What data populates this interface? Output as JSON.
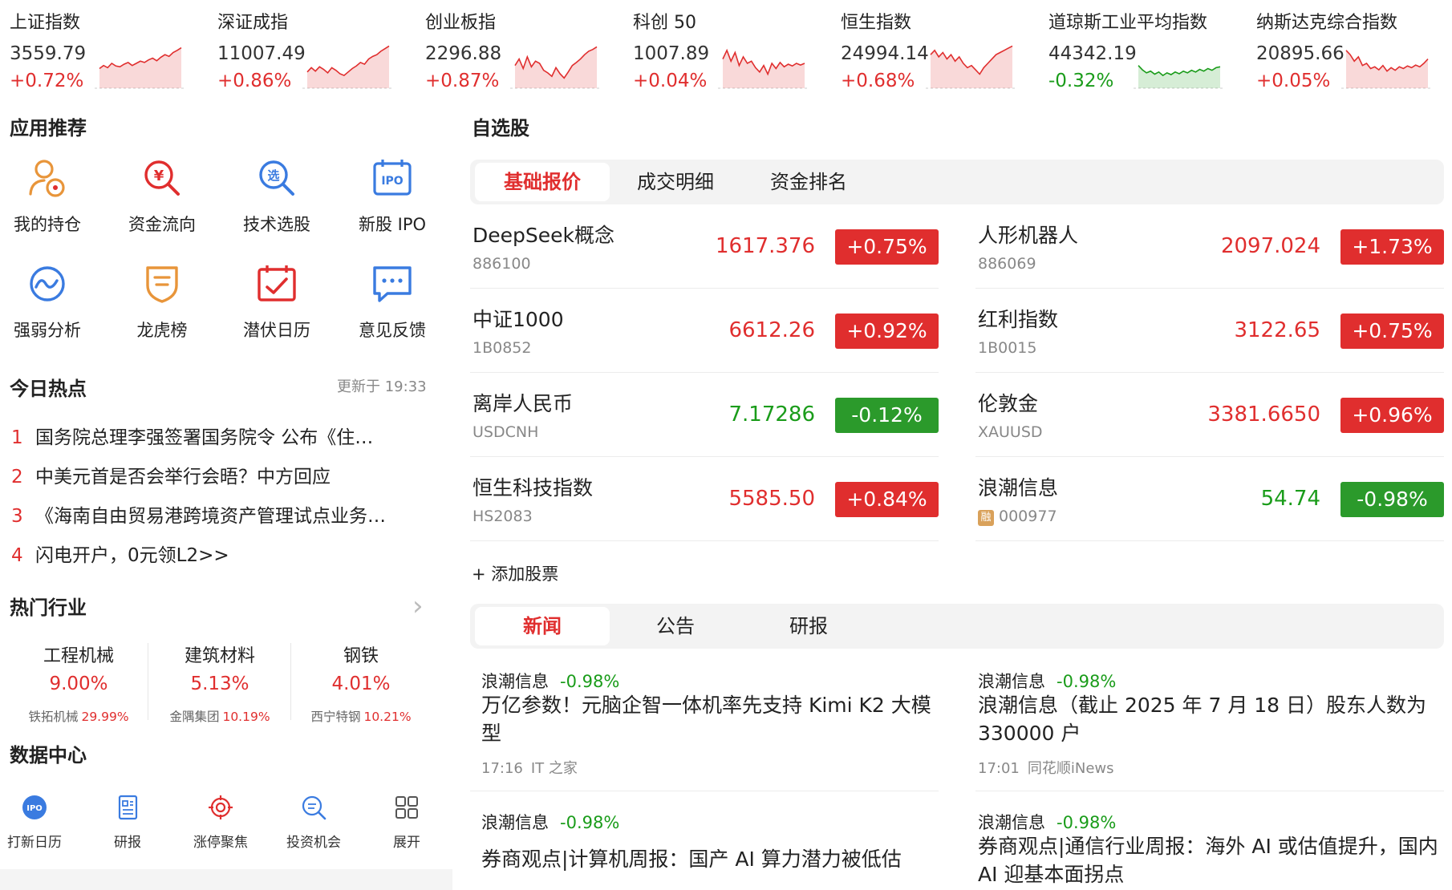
{
  "indices": [
    {
      "name": "上证指数",
      "value": "3559.79",
      "change": "+0.72%",
      "dir": "up"
    },
    {
      "name": "深证成指",
      "value": "11007.49",
      "change": "+0.86%",
      "dir": "up"
    },
    {
      "name": "创业板指",
      "value": "2296.88",
      "change": "+0.87%",
      "dir": "up"
    },
    {
      "name": "科创 50",
      "value": "1007.89",
      "change": "+0.04%",
      "dir": "up"
    },
    {
      "name": "恒生指数",
      "value": "24994.14",
      "change": "+0.68%",
      "dir": "up"
    },
    {
      "name": "道琼斯工业平均指数",
      "value": "44342.19",
      "change": "-0.32%",
      "dir": "down"
    },
    {
      "name": "纳斯达克综合指数",
      "value": "20895.66",
      "change": "+0.05%",
      "dir": "up"
    }
  ],
  "apps": {
    "title": "应用推荐",
    "items": [
      {
        "label": "我的持仓",
        "icon": "holdings-icon"
      },
      {
        "label": "资金流向",
        "icon": "capital-flow-icon"
      },
      {
        "label": "技术选股",
        "icon": "stock-picker-icon"
      },
      {
        "label": "新股 IPO",
        "icon": "ipo-icon"
      },
      {
        "label": "强弱分析",
        "icon": "strength-analysis-icon"
      },
      {
        "label": "龙虎榜",
        "icon": "dragon-tiger-icon"
      },
      {
        "label": "潜伏日历",
        "icon": "calendar-icon"
      },
      {
        "label": "意见反馈",
        "icon": "feedback-icon"
      }
    ]
  },
  "hot": {
    "title": "今日热点",
    "updated": "更新于 19:33",
    "items": [
      {
        "num": "1",
        "text": "国务院总理李强签署国务院令 公布《住…"
      },
      {
        "num": "2",
        "text": "中美元首是否会举行会晤？中方回应"
      },
      {
        "num": "3",
        "text": "《海南自由贸易港跨境资产管理试点业务…"
      },
      {
        "num": "4",
        "text": "闪电开户，0元领L2>>"
      }
    ]
  },
  "industries": {
    "title": "热门行业",
    "chevron": "›",
    "items": [
      {
        "name": "工程机械",
        "pct": "9.00%",
        "leader": "铁拓机械",
        "leader_pct": "29.99%"
      },
      {
        "name": "建筑材料",
        "pct": "5.13%",
        "leader": "金隅集团",
        "leader_pct": "10.19%"
      },
      {
        "name": "钢铁",
        "pct": "4.01%",
        "leader": "西宁特钢",
        "leader_pct": "10.21%"
      }
    ]
  },
  "datacenter": {
    "title": "数据中心",
    "items": [
      {
        "label": "打新日历",
        "icon": "ipo-calendar-icon",
        "icon_text": "IPO"
      },
      {
        "label": "研报",
        "icon": "research-report-icon"
      },
      {
        "label": "涨停聚焦",
        "icon": "limit-up-target-icon"
      },
      {
        "label": "投资机会",
        "icon": "opportunity-search-icon"
      },
      {
        "label": "展开",
        "icon": "expand-grid-icon"
      }
    ]
  },
  "watchlist": {
    "title": "自选股",
    "tabs": [
      "基础报价",
      "成交明细",
      "资金排名"
    ],
    "active_tab": 0,
    "stocks": [
      {
        "name": "DeepSeek概念",
        "code": "886100",
        "price": "1617.376",
        "change": "+0.75%",
        "dir": "up"
      },
      {
        "name": "人形机器人",
        "code": "886069",
        "price": "2097.024",
        "change": "+1.73%",
        "dir": "up"
      },
      {
        "name": "中证1000",
        "code": "1B0852",
        "price": "6612.26",
        "change": "+0.92%",
        "dir": "up"
      },
      {
        "name": "红利指数",
        "code": "1B0015",
        "price": "3122.65",
        "change": "+0.75%",
        "dir": "up"
      },
      {
        "name": "离岸人民币",
        "code": "USDCNH",
        "price": "7.17286",
        "change": "-0.12%",
        "dir": "down"
      },
      {
        "name": "伦敦金",
        "code": "XAUUSD",
        "price": "3381.6650",
        "change": "+0.96%",
        "dir": "up"
      },
      {
        "name": "恒生科技指数",
        "code": "HS2083",
        "price": "5585.50",
        "change": "+0.84%",
        "dir": "up"
      },
      {
        "name": "浪潮信息",
        "code": "000977",
        "badge": "融",
        "price": "54.74",
        "change": "-0.98%",
        "dir": "down"
      }
    ],
    "add_label": "+ 添加股票"
  },
  "news": {
    "tabs": [
      "新闻",
      "公告",
      "研报"
    ],
    "active_tab": 0,
    "items": [
      {
        "stock": "浪潮信息",
        "pct": "-0.98%",
        "title": "万亿参数！元脑企智一体机率先支持 Kimi K2 大模型",
        "time": "17:16",
        "source": "IT 之家"
      },
      {
        "stock": "浪潮信息",
        "pct": "-0.98%",
        "title": "浪潮信息（截止 2025 年 7 月 18 日）股东人数为 330000 户",
        "time": "17:01",
        "source": "同花顺iNews"
      },
      {
        "stock": "浪潮信息",
        "pct": "-0.98%",
        "title": "券商观点|计算机周报：国产 AI 算力潜力被低估",
        "time": "",
        "source": ""
      },
      {
        "stock": "浪潮信息",
        "pct": "-0.98%",
        "title": "券商观点|通信行业周报：海外 AI 或估值提升，国内 AI 迎基本面拐点",
        "time": "",
        "source": ""
      }
    ]
  },
  "colors": {
    "up": "#e02e2e",
    "down": "#1a9c1a",
    "accent": "#e02e2e",
    "icon_blue": "#3a7be0",
    "icon_orange": "#e8953a"
  }
}
